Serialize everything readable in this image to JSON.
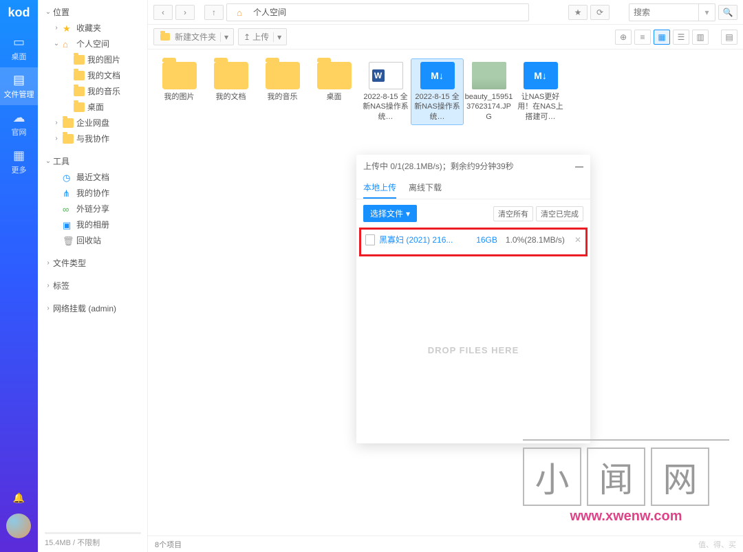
{
  "leftnav": {
    "logo": "kod",
    "items": [
      {
        "icon": "▭",
        "label": "桌面"
      },
      {
        "icon": "▤",
        "label": "文件管理"
      },
      {
        "icon": "☁",
        "label": "官网"
      },
      {
        "icon": "▦",
        "label": "更多"
      }
    ]
  },
  "tree": {
    "location": "位置",
    "favorites": "收藏夹",
    "personal_space": "个人空间",
    "personal_children": [
      {
        "label": "我的图片"
      },
      {
        "label": "我的文档"
      },
      {
        "label": "我的音乐"
      },
      {
        "label": "桌面"
      }
    ],
    "enterprise": "企业网盘",
    "collab": "与我协作",
    "tools": "工具",
    "tools_children": [
      {
        "icon": "◷",
        "label": "最近文档",
        "color": "blue"
      },
      {
        "icon": "⋔",
        "label": "我的协作",
        "color": "blue"
      },
      {
        "icon": "∞",
        "label": "外链分享",
        "color": "green"
      },
      {
        "icon": "▣",
        "label": "我的相册",
        "color": "blue"
      },
      {
        "icon": "🗑",
        "label": "回收站",
        "color": "gray"
      }
    ],
    "filetype": "文件类型",
    "tags": "标签",
    "netmount": "网络挂载 (admin)"
  },
  "storage": "15.4MB / 不限制",
  "breadcrumb": {
    "icon": "⌂",
    "label": "个人空间"
  },
  "search_placeholder": "搜索",
  "toolbar": {
    "newfolder": "新建文件夹",
    "upload": "上传"
  },
  "files": [
    {
      "type": "folder",
      "name": "我的图片"
    },
    {
      "type": "folder",
      "name": "我的文档"
    },
    {
      "type": "folder",
      "name": "我的音乐"
    },
    {
      "type": "folder",
      "name": "桌面"
    },
    {
      "type": "docx",
      "name": "2022-8-15 全新NAS操作系统…"
    },
    {
      "type": "md",
      "name": "2022-8-15 全新NAS操作系统…",
      "selected": true
    },
    {
      "type": "img",
      "name": "beauty_1595137623174.JPG"
    },
    {
      "type": "md",
      "name": "让NAS更好用！在NAS上搭建可…"
    }
  ],
  "statusbar": {
    "left": "8个项目",
    "right": "值、得、买"
  },
  "upload": {
    "title": "上传中 0/1(28.1MB/s)；剩余约9分钟39秒",
    "tab_local": "本地上传",
    "tab_offline": "离线下载",
    "select": "选择文件",
    "clear_all": "清空所有",
    "clear_done": "清空已完成",
    "file": {
      "name": "黑寡妇 (2021) 216...",
      "size": "16GB",
      "progress": "1.0%(28.1MB/s)"
    },
    "drop": "DROP FILES HERE"
  },
  "watermark": {
    "c1": "小",
    "c2": "闻",
    "c3": "网",
    "url": "www.xwenw.com"
  }
}
